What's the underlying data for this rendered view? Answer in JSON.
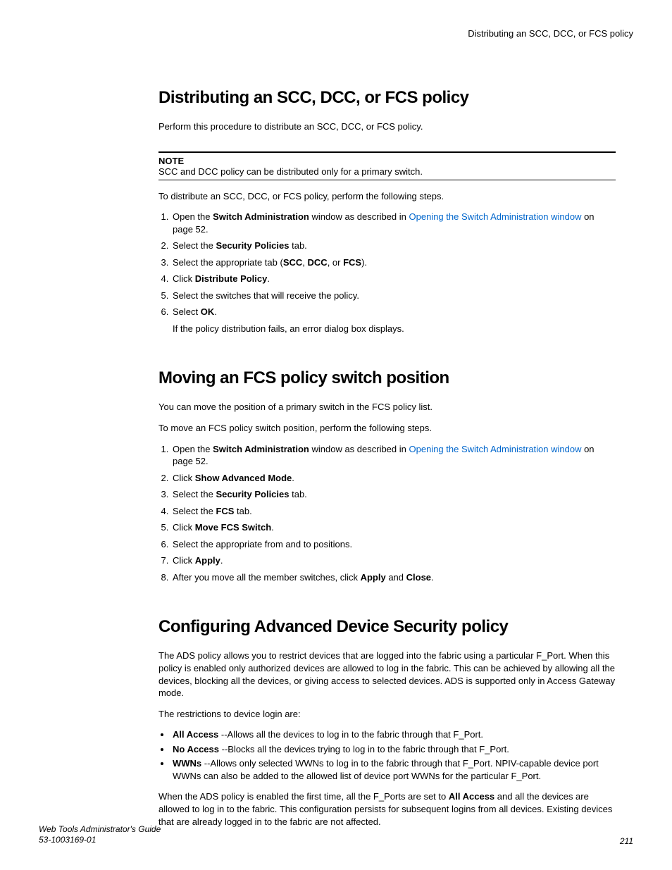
{
  "running_header": "Distributing an SCC, DCC, or FCS policy",
  "sec1": {
    "heading": "Distributing an SCC, DCC, or FCS policy",
    "intro": "Perform this procedure to distribute an SCC, DCC, or FCS policy.",
    "note_label": "NOTE",
    "note_text": "SCC and DCC policy can be distributed only for a primary switch.",
    "lead": "To distribute an SCC, DCC, or FCS policy, perform the following steps.",
    "step1_a": "Open the ",
    "step1_b": "Switch Administration",
    "step1_c": " window as described in ",
    "step1_link": "Opening the Switch Administration window",
    "step1_d": " on page 52.",
    "step2_a": "Select the ",
    "step2_b": "Security Policies",
    "step2_c": " tab.",
    "step3_a": "Select the appropriate tab (",
    "step3_b": "SCC",
    "step3_c": ", ",
    "step3_d": "DCC",
    "step3_e": ", or ",
    "step3_f": "FCS",
    "step3_g": ").",
    "step4_a": "Click ",
    "step4_b": "Distribute Policy",
    "step4_c": ".",
    "step5": "Select the switches that will receive the policy.",
    "step6_a": "Select ",
    "step6_b": "OK",
    "step6_c": ".",
    "step6_sub": "If the policy distribution fails, an error dialog box displays."
  },
  "sec2": {
    "heading": "Moving an FCS policy switch position",
    "intro": "You can move the position of a primary switch in the FCS policy list.",
    "lead": "To move an FCS policy switch position, perform the following steps.",
    "step1_a": "Open the ",
    "step1_b": "Switch Administration",
    "step1_c": " window as described in ",
    "step1_link": "Opening the Switch Administration window",
    "step1_d": " on page 52.",
    "step2_a": "Click ",
    "step2_b": "Show Advanced Mode",
    "step2_c": ".",
    "step3_a": "Select the ",
    "step3_b": "Security Policies",
    "step3_c": " tab.",
    "step4_a": "Select the ",
    "step4_b": "FCS",
    "step4_c": " tab.",
    "step5_a": "Click ",
    "step5_b": "Move FCS Switch",
    "step5_c": ".",
    "step6": "Select the appropriate from and to positions.",
    "step7_a": "Click ",
    "step7_b": "Apply",
    "step7_c": ".",
    "step8_a": "After you move all the member switches, click ",
    "step8_b": "Apply",
    "step8_c": " and ",
    "step8_d": "Close",
    "step8_e": "."
  },
  "sec3": {
    "heading": "Configuring Advanced Device Security policy",
    "p1": "The ADS policy allows you to restrict devices that are logged into the fabric using a particular F_Port. When this policy is enabled only authorized devices are allowed to log in the fabric. This can be achieved by allowing all the devices, blocking all the devices, or giving access to selected devices. ADS is supported only in Access Gateway mode.",
    "p2": "The restrictions to device login are:",
    "b1_a": "All Access",
    "b1_b": " --Allows all the devices to log in to the fabric through that F_Port.",
    "b2_a": "No Access",
    "b2_b": " --Blocks all the devices trying to log in to the fabric through that F_Port.",
    "b3_a": "WWNs",
    "b3_b": " --Allows only selected WWNs to log in to the fabric through that F_Port. NPIV-capable device port WWNs can also be added to the allowed list of device port WWNs for the particular F_Port.",
    "p3_a": "When the ADS policy is enabled the first time, all the F_Ports are set to ",
    "p3_b": "All Access",
    "p3_c": " and all the devices are allowed to log in to the fabric. This configuration persists for subsequent logins from all devices. Existing devices that are already logged in to the fabric are not affected."
  },
  "footer": {
    "title": "Web Tools Administrator's Guide",
    "docnum": "53-1003169-01",
    "pagenum": "211"
  }
}
